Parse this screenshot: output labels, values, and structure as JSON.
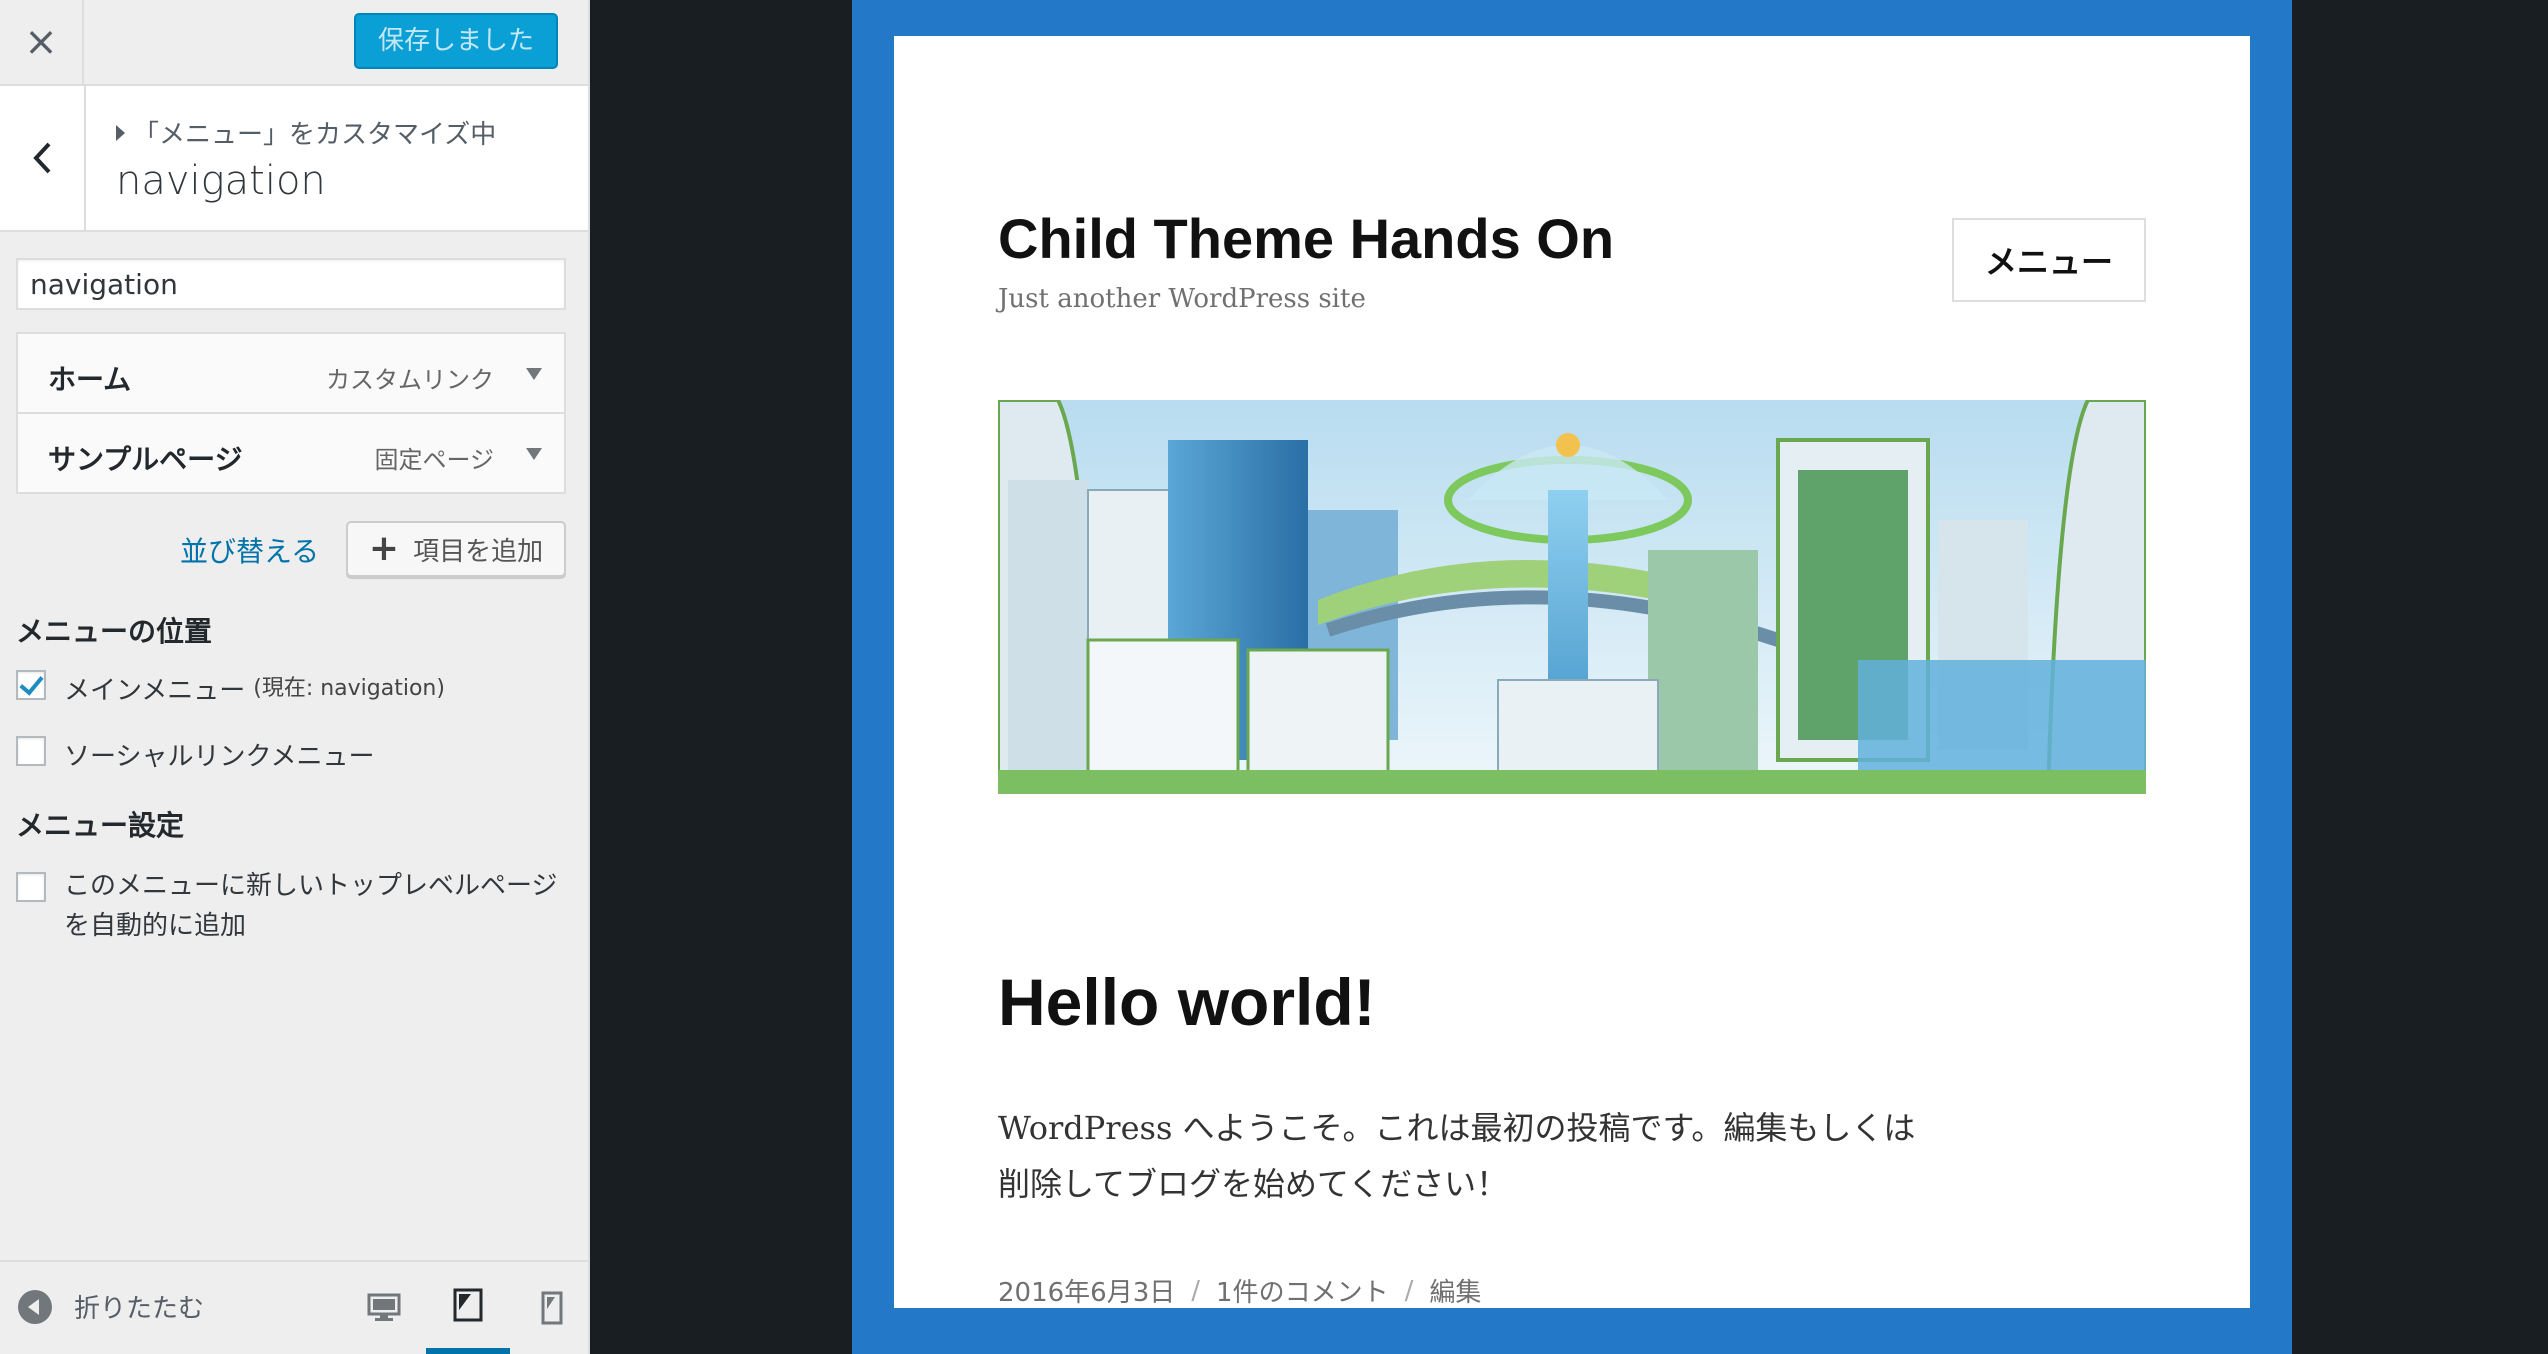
{
  "header": {
    "close_icon": "×",
    "save_label": "保存しました"
  },
  "section": {
    "breadcrumb": "「メニュー」をカスタマイズ中",
    "title": "navigation"
  },
  "menu_name": {
    "value": "navigation"
  },
  "menu_items": [
    {
      "title": "ホーム",
      "type": "カスタムリンク"
    },
    {
      "title": "サンプルページ",
      "type": "固定ページ"
    }
  ],
  "actions": {
    "reorder_label": "並び替える",
    "add_item_label": "項目を追加",
    "add_item_icon": "+"
  },
  "locations": {
    "heading": "メニューの位置",
    "main_label": "メインメニュー",
    "main_note": "(現在: navigation)",
    "main_checked": true,
    "social_label": "ソーシャルリンクメニュー",
    "social_checked": false
  },
  "settings": {
    "heading": "メニュー設定",
    "auto_add_label": "このメニューに新しいトップレベルページを自動的に追加",
    "auto_add_checked": false
  },
  "footer": {
    "collapse_label": "折りたたむ",
    "devices": [
      "desktop-icon",
      "tablet-icon",
      "mobile-icon"
    ],
    "active_device": "tablet"
  },
  "preview": {
    "site_title": "Child Theme Hands On",
    "tagline": "Just another WordPress site",
    "menu_button": "メニュー",
    "post_title": "Hello world!",
    "post_body_line1": "WordPress へようこそ。これは最初の投稿です。編集もしくは",
    "post_body_line2": "削除してブログを始めてください！",
    "post_date": "2016年6月3日",
    "post_comments": "1件のコメント",
    "post_edit": "編集",
    "meta_separator": "/"
  },
  "colors": {
    "accent": "#0073aa",
    "save_button": "#0aa0d6",
    "preview_border": "#2478c8",
    "background": "#191e23"
  }
}
